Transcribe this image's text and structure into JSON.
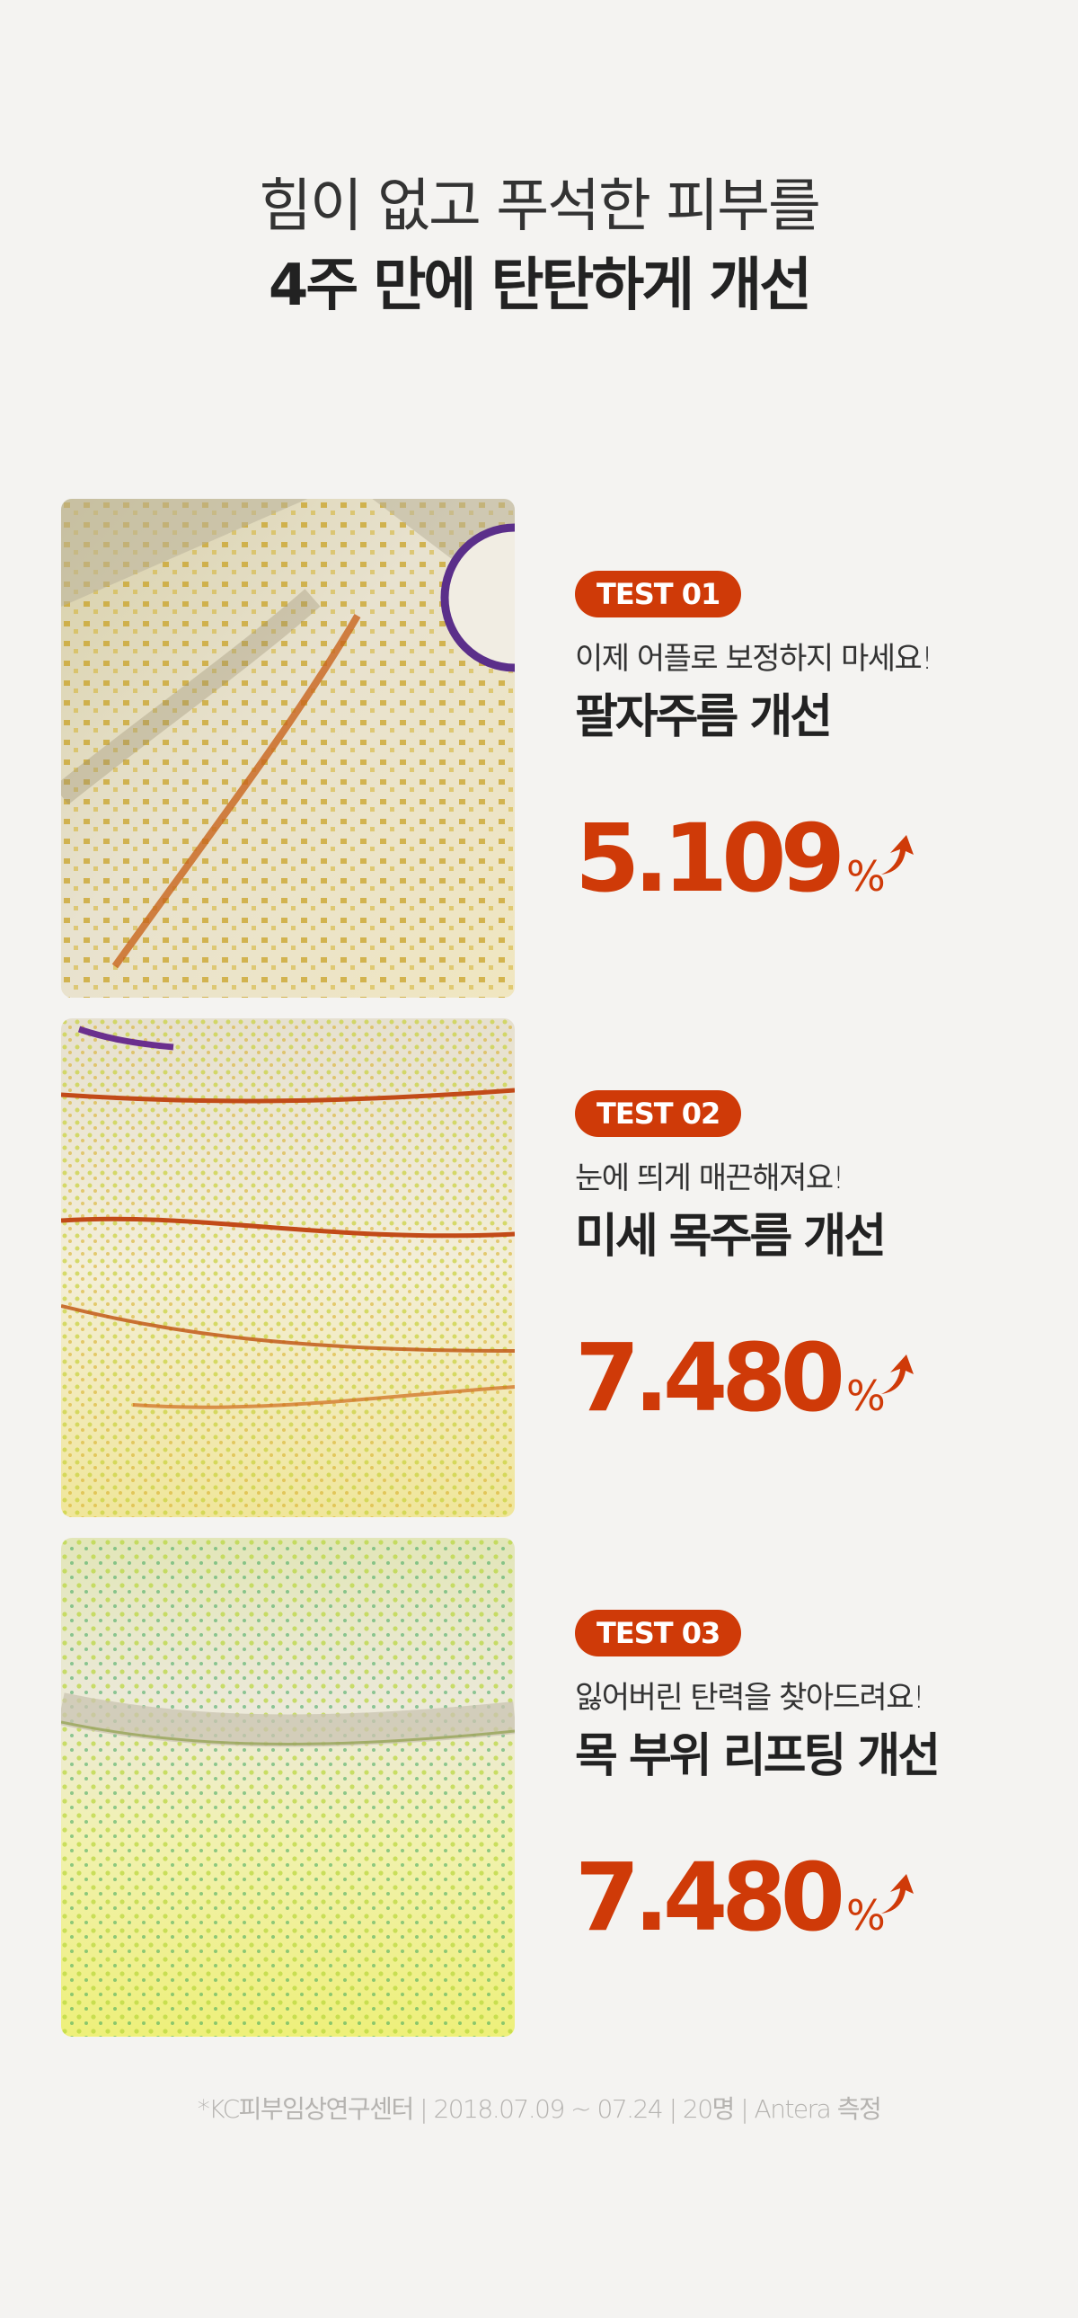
{
  "header": {
    "line1": "힘이 없고 푸석한 피부를",
    "line2": "4주 만에 탄탄하게 개선"
  },
  "tests": [
    {
      "badge": "TEST 01",
      "subtitle": "이제 어플로 보정하지 마세요!",
      "title": "팔자주름 개선",
      "value": "5.109",
      "unit": "%",
      "trend_icon": "arrow-up-icon",
      "image": "nasolabial-fold-skin-analysis"
    },
    {
      "badge": "TEST 02",
      "subtitle": "눈에 띄게 매끈해져요!",
      "title": "미세 목주름 개선",
      "value": "7.480",
      "unit": "%",
      "trend_icon": "arrow-up-icon",
      "image": "neck-wrinkle-skin-analysis"
    },
    {
      "badge": "TEST 03",
      "subtitle": "잃어버린 탄력을 찾아드려요!",
      "title": "목 부위 리프팅 개선",
      "value": "7.480",
      "unit": "%",
      "trend_icon": "arrow-up-icon",
      "image": "neck-lifting-skin-analysis"
    }
  ],
  "footnote": "*KC피부임상연구센터 | 2018.07.09 ~ 07.24 | 20명 | Antera 측정",
  "colors": {
    "accent": "#cf3a08",
    "background": "#f4f3f1",
    "text": "#222222",
    "footnote": "#b5b3b0"
  }
}
